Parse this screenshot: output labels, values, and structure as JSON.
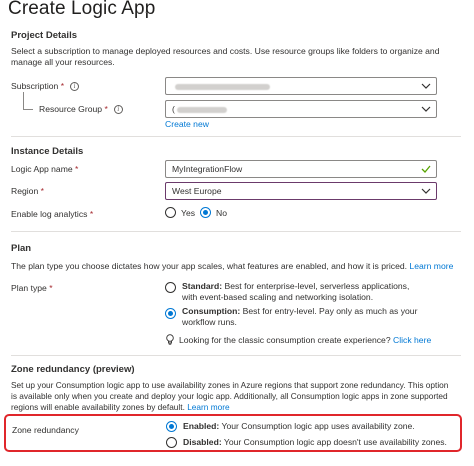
{
  "page": {
    "title": "Create Logic App",
    "more_label": "..."
  },
  "project_details": {
    "heading": "Project Details",
    "description": "Select a subscription to manage deployed resources and costs. Use resource groups like folders to organize and manage all your resources.",
    "subscription_label": "Subscription",
    "resource_group_label": "Resource Group",
    "resource_group_value_prefix": "(",
    "create_new_link": "Create new"
  },
  "instance_details": {
    "heading": "Instance Details",
    "logic_app_name_label": "Logic App name",
    "logic_app_name_value": "MyIntegrationFlow",
    "region_label": "Region",
    "region_value": "West Europe",
    "log_analytics_label": "Enable log analytics",
    "log_analytics_options": [
      "Yes",
      "No"
    ],
    "log_analytics_selected": "No"
  },
  "plan": {
    "heading": "Plan",
    "description": "The plan type you choose dictates how your app scales, what features are enabled, and how it is priced.",
    "learn_more": "Learn more",
    "plan_type_label": "Plan type",
    "standard_title": "Standard:",
    "standard_desc_1": "Best for enterprise-level, serverless applications,",
    "standard_desc_2": "with event-based scaling and networking isolation.",
    "consumption_title": "Consumption:",
    "consumption_desc_1": "Best for entry-level. Pay only as much as your",
    "consumption_desc_2": "workflow runs.",
    "selected": "Consumption",
    "classic_note": "Looking for the classic consumption create experience?",
    "classic_link": "Click here"
  },
  "zone_redundancy": {
    "heading": "Zone redundancy (preview)",
    "description_1": "Set up your Consumption logic app to use availability zones in Azure regions that support zone redundancy. This option",
    "description_2": "is available only when you create and deploy your logic app. Additionally, all Consumption logic apps in zone supported",
    "description_3": "regions will enable availability zones by default.",
    "learn_more": "Learn more",
    "label": "Zone redundancy",
    "enabled_title": "Enabled:",
    "enabled_desc": "Your Consumption logic app uses availability zone.",
    "disabled_title": "Disabled:",
    "disabled_desc": "Your Consumption logic app doesn't use availability zones.",
    "selected": "Enabled"
  },
  "colors": {
    "accent": "#0078d4",
    "required": "#a4262c",
    "highlight_border": "#e0262b",
    "valid_check": "#57a300"
  }
}
